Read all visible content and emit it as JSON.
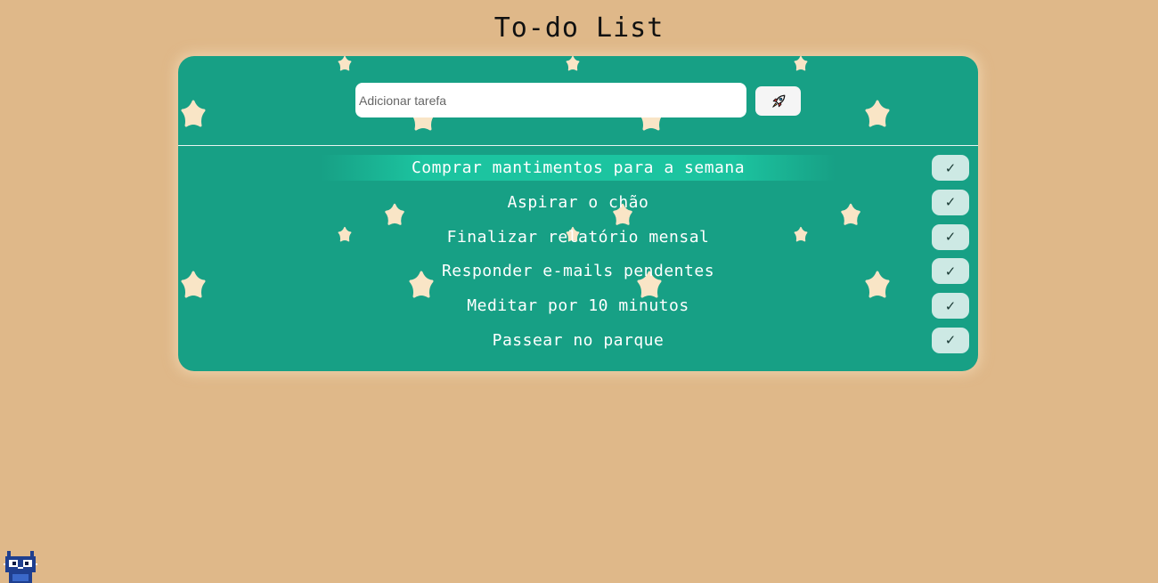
{
  "page": {
    "title": "To-do List"
  },
  "input": {
    "placeholder": "Adicionar tarefa",
    "value": ""
  },
  "add_button": {
    "icon": "rocket-icon"
  },
  "tasks": [
    {
      "text": "Comprar mantimentos para a semana",
      "check_label": "✓",
      "highlighted": true
    },
    {
      "text": "Aspirar o chão",
      "check_label": "✓",
      "highlighted": false
    },
    {
      "text": "Finalizar relatório mensal",
      "check_label": "✓",
      "highlighted": false
    },
    {
      "text": "Responder e-mails pendentes",
      "check_label": "✓",
      "highlighted": false
    },
    {
      "text": "Meditar por 10 minutos",
      "check_label": "✓",
      "highlighted": false
    },
    {
      "text": "Passear no parque",
      "check_label": "✓",
      "highlighted": false
    }
  ],
  "colors": {
    "background": "#dfb889",
    "card": "#17a085",
    "star": "#f9e5c6",
    "check_button": "#cde9e4",
    "highlight": "#1cc4a0"
  },
  "decor": {
    "background_pattern": "star-icon",
    "mascot": "pixel-cat-icon"
  }
}
